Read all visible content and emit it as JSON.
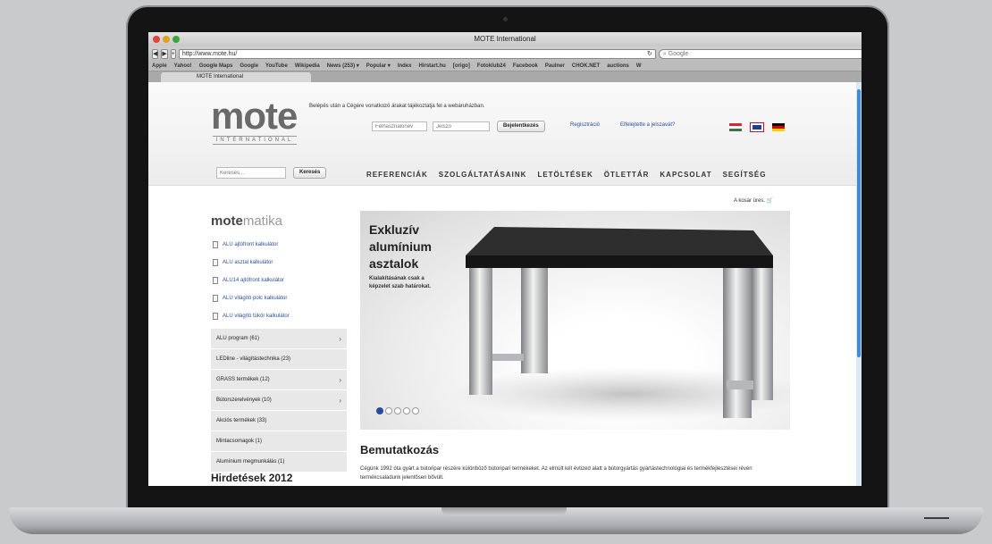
{
  "browser": {
    "window_title": "MOTE International",
    "url": "http://www.mote.hu/",
    "search_placeholder": "Google",
    "tab_title": "MOTE International",
    "bookmarks": [
      "Apple",
      "Yahoo!",
      "Google Maps",
      "Google",
      "YouTube",
      "Wikipedia",
      "News (253) ▾",
      "Popular ▾",
      "Index",
      "Hirstart.hu",
      "[origo]",
      "Fotoklub24",
      "Facebook",
      "Paulner",
      "CHOK.NET",
      "auctions",
      "W"
    ]
  },
  "header": {
    "logo": "mote",
    "logo_sub": "INTERNATIONAL",
    "login_hint": "Belépés után a Cégére vonatkozó árakat tájékoztatja fel a webáruházban.",
    "username_placeholder": "Felhasználónév",
    "password_placeholder": "Jelszó",
    "login_button": "Bejelentkezés",
    "register_link": "Regisztráció",
    "forgot_link": "Elfelejtette a jelszavát?",
    "search_placeholder": "Keresés...",
    "search_button": "Keresés"
  },
  "nav": [
    "REFERENCIÁK",
    "SZOLGÁLTATÁSAINK",
    "LETÖLTÉSEK",
    "ÖTLETTÁR",
    "KAPCSOLAT",
    "SEGÍTSÉG"
  ],
  "cart": "A kosár üres.",
  "motematika": {
    "bold": "mote",
    "light": "matika"
  },
  "calculators": [
    "ALU ajtófront kalkulátor",
    "ALU asztal kalkulátor",
    "ALU14 ajtófront kalkulátor",
    "ALU világító polc kalkulátor",
    "ALU világító tükör kalkulátor"
  ],
  "categories": [
    {
      "label": "ALU program (61)",
      "arrow": "›"
    },
    {
      "label": "LEDline - világítástechnika (23)",
      "arrow": ""
    },
    {
      "label": "GRASS termékek (12)",
      "arrow": "›"
    },
    {
      "label": "Bútorszerelvények (10)",
      "arrow": "›"
    },
    {
      "label": "Akciós termékek (33)",
      "arrow": ""
    },
    {
      "label": "Mintacsomagok (1)",
      "arrow": ""
    },
    {
      "label": "Alumínium megmunkálás (1)",
      "arrow": ""
    }
  ],
  "ads_title": "Hirdetések 2012",
  "slider": {
    "headline": "Exkluzív alumínium asztalok",
    "text": "Kialakításának csak a képzelet szab határokat.",
    "active_dot": 0,
    "dot_count": 5
  },
  "intro": {
    "title": "Bemutatkozás",
    "text": "Cégünk 1992 óta gyárt a bútoripar részére különböző bútoripari termékeket. Az elmúlt két évtized alatt a bútorgyártás gyártástechnológiai és termékfejlesztései révén termékcsaládunk jelentősen bővült."
  },
  "colors": {
    "link": "#2a4f9a",
    "accent": "#2b4c9c"
  }
}
